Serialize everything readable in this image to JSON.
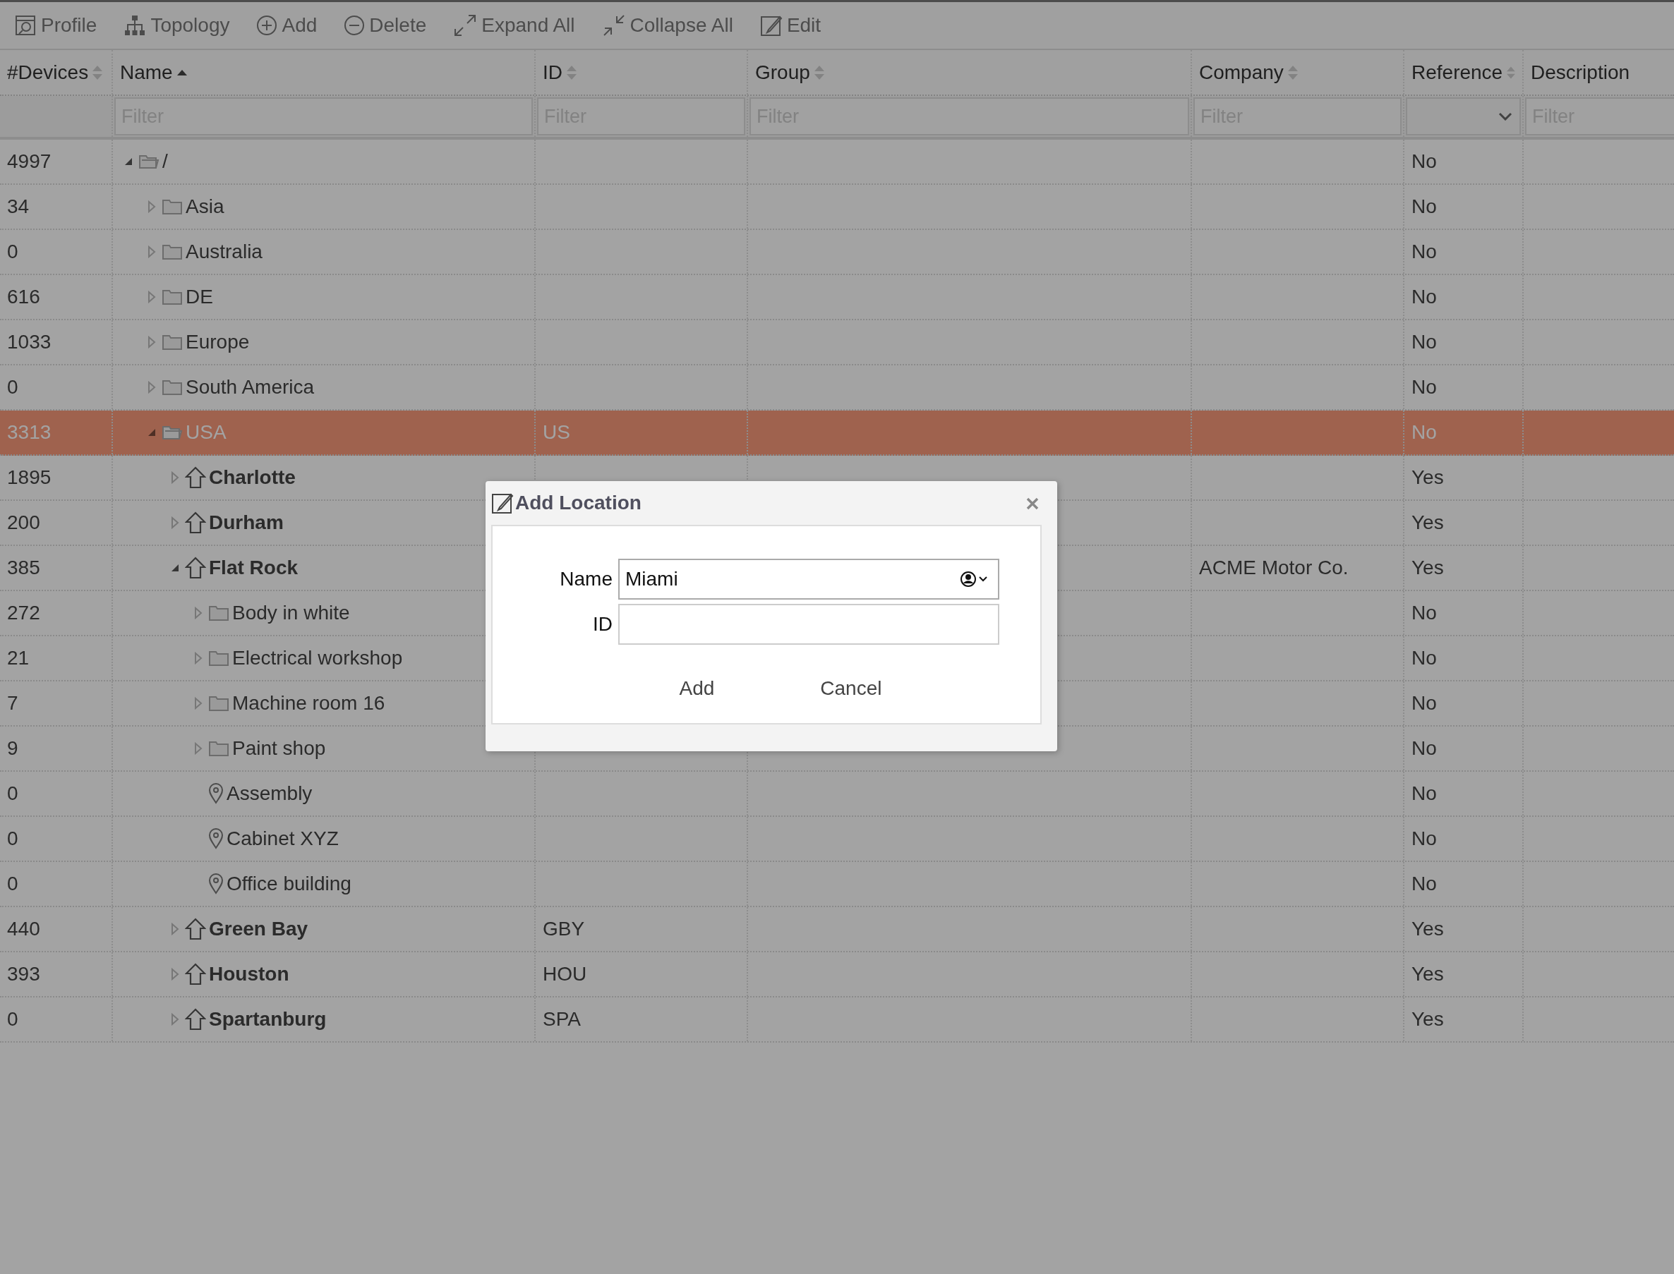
{
  "toolbar": [
    "Profile",
    "Topology",
    "Add",
    "Delete",
    "Expand All",
    "Collapse All",
    "Edit"
  ],
  "table": {
    "columns": [
      {
        "label": "#Devices",
        "sorted": false
      },
      {
        "label": "Name",
        "sorted": true,
        "filter": {
          "kind": "text",
          "placeholder": "Filter"
        }
      },
      {
        "label": "ID",
        "sorted": false,
        "filter": {
          "kind": "text",
          "placeholder": "Filter"
        }
      },
      {
        "label": "Group",
        "sorted": false,
        "filter": {
          "kind": "text",
          "placeholder": "Filter"
        }
      },
      {
        "label": "Company",
        "sorted": false,
        "filter": {
          "kind": "text",
          "placeholder": "Filter"
        }
      },
      {
        "label": "Reference",
        "sorted": false,
        "filter": {
          "kind": "select"
        }
      },
      {
        "label": "Description",
        "filter": {
          "kind": "text",
          "placeholder": "Filter"
        }
      }
    ],
    "tree": [
      {
        "devices": "4997",
        "name": "/",
        "kind": "folder",
        "expanded": true,
        "reference": "No",
        "selected": false,
        "children": [
          {
            "devices": "34",
            "name": "Asia",
            "kind": "folder",
            "expanded": false,
            "reference": "No",
            "selected": false
          },
          {
            "devices": "0",
            "name": "Australia",
            "kind": "folder",
            "expanded": false,
            "reference": "No",
            "selected": false
          },
          {
            "devices": "616",
            "name": "DE",
            "kind": "folder",
            "expanded": false,
            "reference": "No",
            "selected": false
          },
          {
            "devices": "1033",
            "name": "Europe",
            "kind": "folder",
            "expanded": false,
            "reference": "No",
            "selected": false
          },
          {
            "devices": "0",
            "name": "South America",
            "kind": "folder",
            "expanded": false,
            "reference": "No",
            "selected": false
          },
          {
            "devices": "3313",
            "name": "USA",
            "kind": "folder",
            "expanded": true,
            "id": "US",
            "reference": "No",
            "selected": true,
            "children": [
              {
                "devices": "1895",
                "name": "Charlotte",
                "kind": "site",
                "expanded": false,
                "reference": "Yes",
                "selected": false
              },
              {
                "devices": "200",
                "name": "Durham",
                "kind": "site",
                "expanded": false,
                "reference": "Yes",
                "selected": false
              },
              {
                "devices": "385",
                "name": "Flat Rock",
                "kind": "site",
                "expanded": true,
                "company": "ACME Motor Co.",
                "reference": "Yes",
                "selected": false,
                "children": [
                  {
                    "devices": "272",
                    "name": "Body in white",
                    "kind": "folder",
                    "expanded": false,
                    "reference": "No",
                    "selected": false
                  },
                  {
                    "devices": "21",
                    "name": "Electrical workshop",
                    "kind": "folder",
                    "expanded": false,
                    "reference": "No",
                    "selected": false
                  },
                  {
                    "devices": "7",
                    "name": "Machine room 16",
                    "kind": "folder",
                    "expanded": false,
                    "reference": "No",
                    "selected": false
                  },
                  {
                    "devices": "9",
                    "name": "Paint shop",
                    "kind": "folder",
                    "expanded": false,
                    "reference": "No",
                    "selected": false
                  },
                  {
                    "devices": "0",
                    "name": "Assembly",
                    "kind": "place",
                    "reference": "No",
                    "selected": false
                  },
                  {
                    "devices": "0",
                    "name": "Cabinet XYZ",
                    "kind": "place",
                    "reference": "No",
                    "selected": false
                  },
                  {
                    "devices": "0",
                    "name": "Office building",
                    "kind": "place",
                    "reference": "No",
                    "selected": false
                  }
                ]
              },
              {
                "devices": "440",
                "name": "Green Bay",
                "kind": "site",
                "expanded": false,
                "id": "GBY",
                "reference": "Yes",
                "selected": false
              },
              {
                "devices": "393",
                "name": "Houston",
                "kind": "site",
                "expanded": false,
                "id": "HOU",
                "reference": "Yes",
                "selected": false
              },
              {
                "devices": "0",
                "name": "Spartanburg",
                "kind": "site",
                "expanded": false,
                "id": "SPA",
                "reference": "Yes",
                "selected": false
              }
            ]
          }
        ]
      }
    ]
  },
  "dialog": {
    "title": "Add Location",
    "fields": [
      {
        "label": "Name",
        "value": "Miami",
        "autofill": true
      },
      {
        "label": "ID"
      }
    ],
    "buttons": [
      "Add",
      "Cancel"
    ]
  }
}
